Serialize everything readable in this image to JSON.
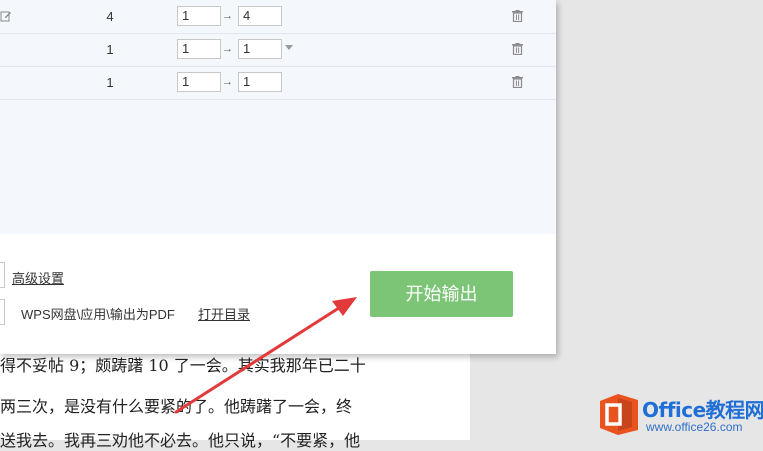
{
  "rows": [
    {
      "pages": "4",
      "from": "1",
      "to": "4",
      "arrow": "→"
    },
    {
      "pages": "1",
      "from": "1",
      "to": "1",
      "arrow": "→"
    },
    {
      "pages": "1",
      "from": "1",
      "to": "1",
      "arrow": "→"
    }
  ],
  "settings": {
    "advanced_label": "高级设置",
    "output_path": "WPS网盘\\应用\\输出为PDF",
    "open_dir_label": "打开目录"
  },
  "start_button": {
    "label": "开始输出",
    "color": "#7cc576"
  },
  "document": {
    "lines": [
      "得不妥帖 9；颇踌躇 10 了一会。其实我那年已二十",
      "两三次，是没有什么要紧的了。他踌躇了一会，终",
      "送我去。我再三劝他不必去。他只说，“不要紧，他"
    ]
  },
  "watermark": {
    "name": "Office教程网",
    "url": "www.office26.com",
    "icon_color": "#e8531e"
  },
  "icons": {
    "edit": "edit-icon",
    "trash": "trash-icon",
    "dropdown": "chevron-down-icon"
  }
}
